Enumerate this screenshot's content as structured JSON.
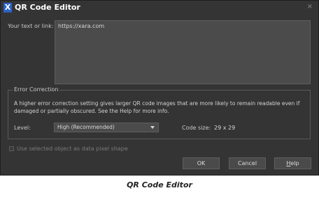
{
  "window": {
    "title": "QR Code Editor",
    "app_icon": "xara-icon",
    "close_glyph": "×"
  },
  "text_field": {
    "label": "Your text or link:",
    "value": "https://xara.com"
  },
  "error_correction": {
    "group_title": "Error Correction",
    "description": "A higher error correction setting gives larger QR code images that are more likely to remain readable even if damaged or partially obscured. See the Help for more info.",
    "level_label": "Level:",
    "level_value": "High (Recommended)",
    "code_size_label": "Code size:",
    "code_size_value": "29 x 29"
  },
  "option": {
    "checkbox_label": "Use selected object as data pixel shape",
    "checked": false
  },
  "buttons": {
    "ok": "OK",
    "cancel": "Cancel",
    "help_prefix": "H",
    "help_rest": "elp"
  },
  "caption": "QR Code Editor",
  "colors": {
    "dialog_bg": "#343434",
    "field_bg": "#4b4b4b",
    "brand_icon": "#2b62c6"
  }
}
